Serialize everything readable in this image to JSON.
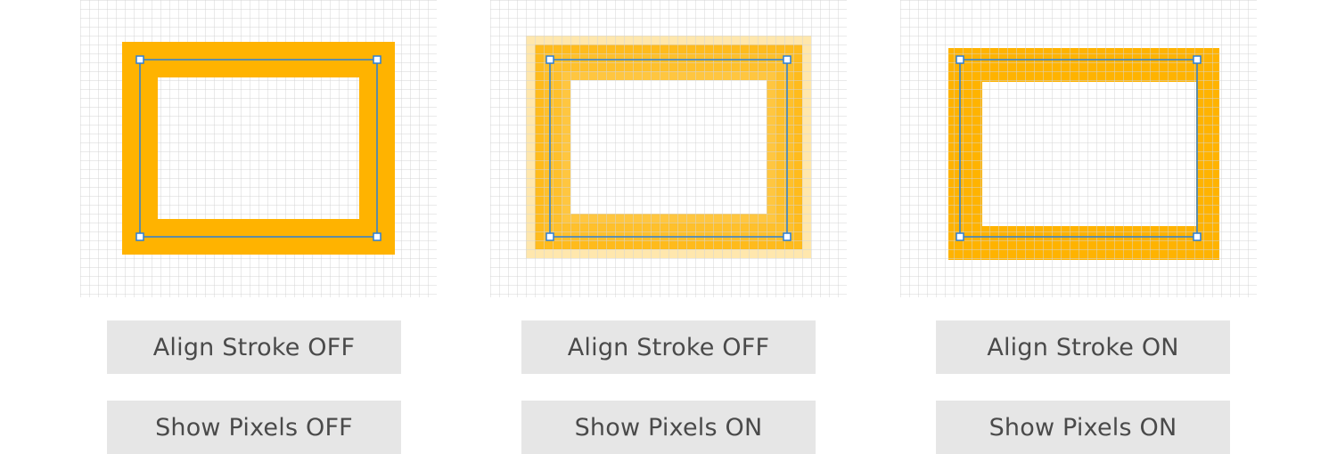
{
  "colors": {
    "stroke_fill": "#ffb300",
    "selection": "#2b7fd8",
    "grid": "#d4d4d4",
    "label_bg": "#e6e6e6",
    "label_text": "#4a4a4a"
  },
  "panels": [
    {
      "mode": "smooth",
      "align_stroke": "Align Stroke OFF",
      "show_pixels": "Show Pixels OFF"
    },
    {
      "mode": "antialiased-pixels",
      "align_stroke": "Align Stroke OFF",
      "show_pixels": "Show Pixels ON"
    },
    {
      "mode": "aligned-pixels",
      "align_stroke": "Align Stroke ON",
      "show_pixels": "Show Pixels ON"
    }
  ]
}
